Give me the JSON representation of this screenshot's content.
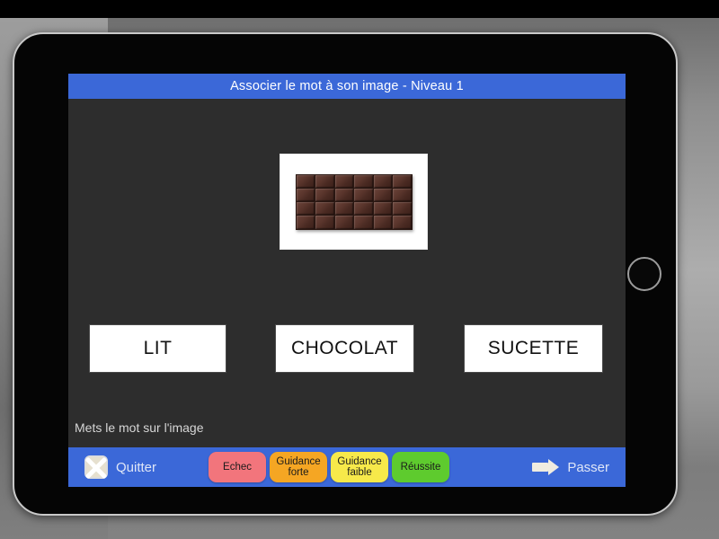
{
  "app": {
    "title": "Associer le mot à son image - Niveau 1"
  },
  "stage": {
    "image": {
      "alt_name": "chocolate-bar-photo",
      "columns": 6,
      "rows": 4
    },
    "word_cards": [
      {
        "label": "LIT"
      },
      {
        "label": "CHOCOLAT"
      },
      {
        "label": "SUCETTE"
      }
    ],
    "instruction": "Mets le mot sur l'image",
    "drop_marker_color": "#3b68d8"
  },
  "toolbar": {
    "quit_label": "Quitter",
    "pass_label": "Passer",
    "quit_icon": "x-cross-icon",
    "pass_icon": "arrow-right-icon",
    "rating_buttons": [
      {
        "line1": "Echec",
        "line2": "",
        "color": "#f2757c"
      },
      {
        "line1": "Guidance",
        "line2": "forte",
        "color": "#f5a623"
      },
      {
        "line1": "Guidance",
        "line2": "faible",
        "color": "#f7e94a"
      },
      {
        "line1": "Réussite",
        "line2": "",
        "color": "#5ecb2e"
      }
    ],
    "background_color": "#3b68d8"
  },
  "device": {
    "frame": "tablet",
    "home_button": "home-button"
  }
}
